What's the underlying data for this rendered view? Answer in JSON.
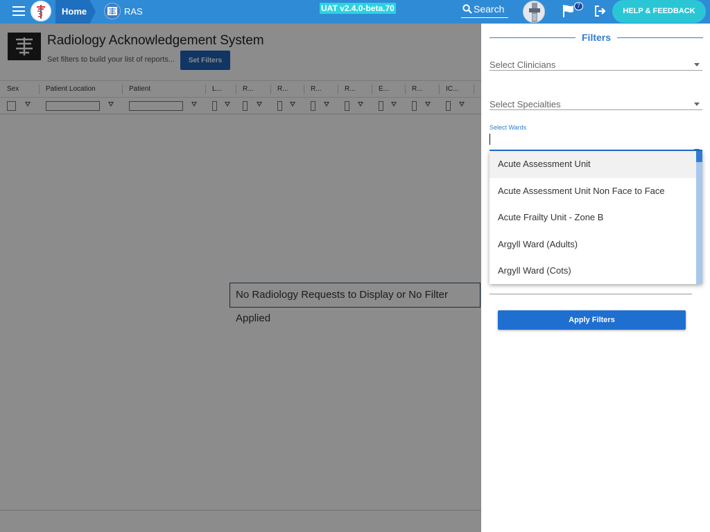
{
  "topbar": {
    "home_label": "Home",
    "app_label": "RAS",
    "version": "UAT v2.4.0-beta.70",
    "search_label": "Search",
    "notification_count": "7",
    "help_label": "HELP & FEEDBACK",
    "colors": {
      "bar": "#2f8bd6",
      "version_bg": "#2bd3e0",
      "help_bg": "#2bc6d6"
    }
  },
  "page": {
    "title": "Radiology Acknowledgement System",
    "subtitle": "Set filters to build your list of reports...",
    "set_filters_label": "Set Filters",
    "columns": [
      "Sex",
      "Patient Location",
      "Patient",
      "L...",
      "R...",
      "R...",
      "R...",
      "R...",
      "E...",
      "R...",
      "IC..."
    ],
    "empty_message": "No Radiology Requests to Display or No Filter Applied"
  },
  "filters": {
    "title": "Filters",
    "clinicians_placeholder": "Select Clinicians",
    "specialties_placeholder": "Select Specialties",
    "wards_label": "Select Wards",
    "ward_options": [
      "Acute Assessment Unit",
      "Acute Assessment Unit Non Face to Face",
      "Acute Frailty Unit - Zone B",
      "Argyll Ward (Adults)",
      "Argyll Ward (Cots)"
    ],
    "apply_label": "Apply Filters"
  }
}
